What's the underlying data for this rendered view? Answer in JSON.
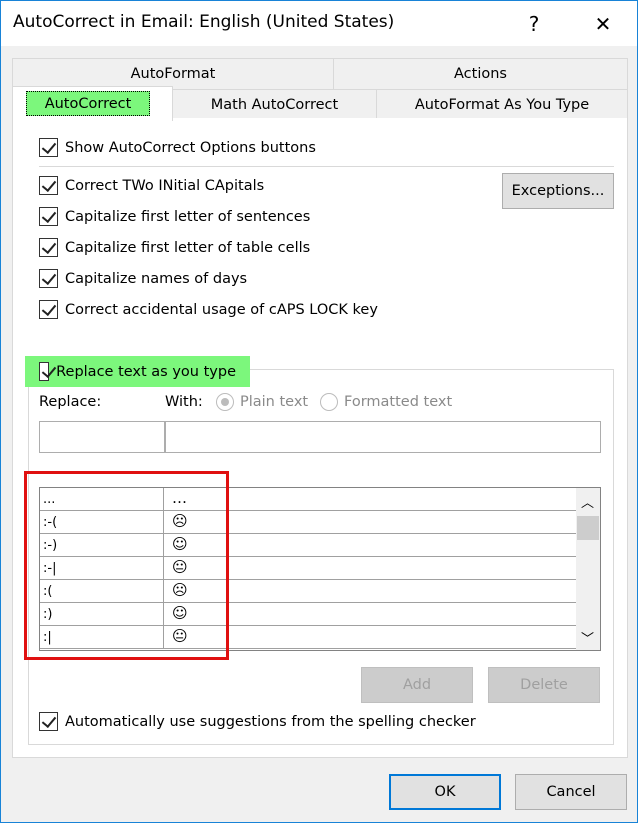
{
  "title": "AutoCorrect in Email: English (United States)",
  "help_label": "?",
  "close_label": "✕",
  "tabs_back": [
    "AutoFormat",
    "Actions"
  ],
  "tabs_front": [
    "AutoCorrect",
    "Math AutoCorrect",
    "AutoFormat As You Type"
  ],
  "active_tab": "AutoCorrect",
  "options": {
    "show_buttons": "Show AutoCorrect Options buttons",
    "two_initial": "Correct TWo INitial CApitals",
    "first_sentence": "Capitalize first letter of sentences",
    "first_table": "Capitalize first letter of table cells",
    "names_days": "Capitalize names of days",
    "caps_lock": "Correct accidental usage of cAPS LOCK key",
    "replace_text": "Replace text as you type",
    "suggestions": "Automatically use suggestions from the spelling checker"
  },
  "exceptions_label": "Exceptions...",
  "replace_label": "Replace:",
  "with_label": "With:",
  "plain_text": "Plain text",
  "formatted_text": "Formatted text",
  "replace_value": "",
  "with_value": "",
  "entries": [
    {
      "from": "...",
      "to": "…"
    },
    {
      "from": ":-(",
      "to": "☹"
    },
    {
      "from": ":-)",
      "to": "☺"
    },
    {
      "from": ":-|",
      "to": "😐"
    },
    {
      "from": ":(",
      "to": "☹"
    },
    {
      "from": ":)",
      "to": "☺"
    },
    {
      "from": ":|",
      "to": "😐"
    }
  ],
  "add_label": "Add",
  "delete_label": "Delete",
  "ok_label": "OK",
  "cancel_label": "Cancel",
  "highlight_color": "#7cf77c",
  "annotation_color": "#e01010"
}
